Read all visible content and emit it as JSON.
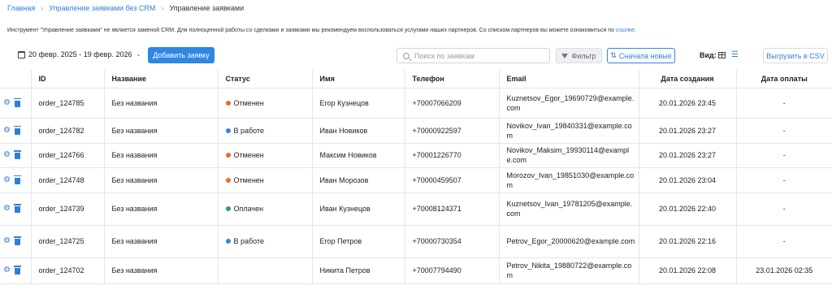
{
  "breadcrumb": {
    "items": [
      "Главная",
      "Управление заявками без CRM"
    ],
    "current": "Управление заявками"
  },
  "notice": {
    "text": "Инструмент \"Управление заявками\" не является заменой CRM. Для полноценной работы со сделками и заявками мы рекомендуем воспользоваться услугами наших партнеров. Со списком партнеров вы можете ознакомиться по",
    "link": "ссылке."
  },
  "toolbar": {
    "date_range": "20 февр. 2025 - 19 февр. 2026",
    "add_button": "Добавить заявку",
    "search_placeholder": "Поиск по заявкам",
    "filter_button": "Фильтр",
    "sort_button": "Сначала новые",
    "view_label": "Вид:",
    "export_button": "Выгрузить в CSV"
  },
  "colors": {
    "accent": "#2f87e4",
    "status_cancelled": "#f26b1d",
    "status_in_progress": "#2f87e4",
    "status_paid": "#21a35a"
  },
  "table": {
    "columns": [
      "",
      "ID",
      "Название",
      "Статус",
      "Имя",
      "Телефон",
      "Email",
      "Дата создания",
      "Дата оплаты"
    ],
    "rows": [
      {
        "id": "order_124785",
        "name": "Без названия",
        "status": "Отменен",
        "status_color": "#f26b1d",
        "person": "Егор Кузнецов",
        "phone": "+70007066209",
        "email": "Kuznetsov_Egor_19690729@example.com",
        "created": "20.01.2026 23:45",
        "paid": "-"
      },
      {
        "id": "order_124782",
        "name": "Без названия",
        "status": "В работе",
        "status_color": "#2f87e4",
        "person": "Иван Новиков",
        "phone": "+70000922597",
        "email": "Novikov_Ivan_19840331@example.com",
        "created": "20.01.2026 23:27",
        "paid": "-"
      },
      {
        "id": "order_124766",
        "name": "Без названия",
        "status": "Отменен",
        "status_color": "#f26b1d",
        "person": "Максим Новиков",
        "phone": "+70001226770",
        "email": "Novikov_Maksim_19930114@example.com",
        "created": "20.01.2026 23:27",
        "paid": "-"
      },
      {
        "id": "order_124748",
        "name": "Без названия",
        "status": "Отменен",
        "status_color": "#f26b1d",
        "person": "Иван Морозов",
        "phone": "+70000459507",
        "email": "Morozov_Ivan_19851030@example.com",
        "created": "20.01.2026 23:04",
        "paid": "-"
      },
      {
        "id": "order_124739",
        "name": "Без названия",
        "status": "Оплачен",
        "status_color": "#21a35a",
        "person": "Иван Кузнецов",
        "phone": "+70008124371",
        "email": "Kuznetsov_Ivan_19781205@example.com",
        "created": "20.01.2026 22:40",
        "paid": "-"
      },
      {
        "id": "order_124725",
        "name": "Без названия",
        "status": "В работе",
        "status_color": "#2f87e4",
        "person": "Егор Петров",
        "phone": "+70000730354",
        "email": "Petrov_Egor_20000620@example.com",
        "created": "20.01.2026 22:16",
        "paid": "-"
      },
      {
        "id": "order_124702",
        "name": "Без названия",
        "status": "",
        "status_color": "",
        "person": "Никита Петров",
        "phone": "+70007794490",
        "email": "Petrov_Nikita_19880722@example.com",
        "created": "20.01.2026 22:08",
        "paid": "23.01.2026 02:35"
      }
    ]
  }
}
